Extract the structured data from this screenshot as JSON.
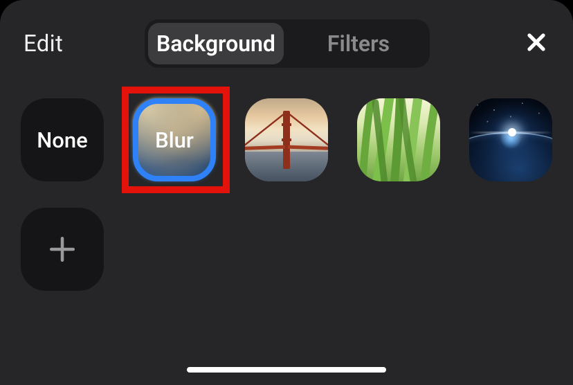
{
  "header": {
    "edit_label": "Edit",
    "close_icon": "close-icon",
    "tabs": {
      "background_label": "Background",
      "filters_label": "Filters",
      "active": "background"
    }
  },
  "backgrounds": {
    "none_label": "None",
    "blur_label": "Blur",
    "selected": "blur",
    "images": [
      {
        "id": "bridge",
        "name": "background-option-bridge"
      },
      {
        "id": "grass",
        "name": "background-option-grass"
      },
      {
        "id": "earth",
        "name": "background-option-earth"
      }
    ],
    "add_icon": "plus-icon"
  },
  "highlight": {
    "target": "blur",
    "color": "#e3120b"
  }
}
